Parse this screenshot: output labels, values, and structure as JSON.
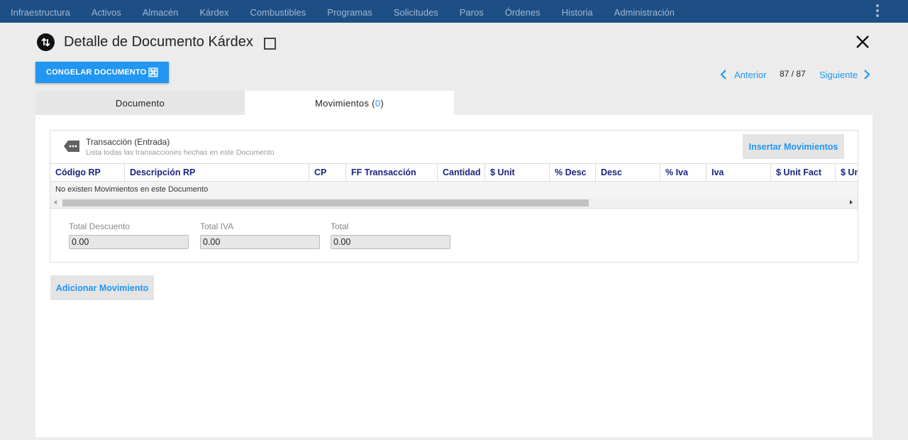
{
  "nav": {
    "items": [
      "Infraestructura",
      "Activos",
      "Almacén",
      "Kárdex",
      "Combustibles",
      "Programas",
      "Solicitudes",
      "Paros",
      "Órdenes",
      "Historia",
      "Administración"
    ]
  },
  "header": {
    "title": "Detalle de Documento Kárdex"
  },
  "toolbar": {
    "freeze_label": "CONGELAR DOCUMENTO"
  },
  "pager": {
    "prev_label": "Anterior",
    "count": "87 / 87",
    "next_label": "Siguiente"
  },
  "tabs": {
    "documento": "Documento",
    "movimientos_label": "Movimientos (",
    "movimientos_count": "0",
    "movimientos_close": ")"
  },
  "card": {
    "title": "Transacción (Entrada)",
    "subtitle": "Lista todas las transacciones hechas en este Documento",
    "insert_label": "Insertar Movimientos"
  },
  "grid": {
    "columns": [
      "Código RP",
      "Descripción RP",
      "CP",
      "FF Transacción",
      "Cantidad",
      "$ Unit",
      "% Desc",
      "Desc",
      "% Iva",
      "Iva",
      "$ Unit Fact",
      "$ Un"
    ],
    "empty_text": "No existen Movimientos en este Documento"
  },
  "totals": {
    "descuento_label": "Total Descuento",
    "descuento_value": "0.00",
    "iva_label": "Total IVA",
    "iva_value": "0.00",
    "total_label": "Total",
    "total_value": "0.00"
  },
  "actions": {
    "add_label": "Adicionar Movimiento"
  },
  "colors": {
    "nav_bg": "#1d4f84",
    "accent": "#2196f3",
    "header_text": "#1a237e"
  }
}
